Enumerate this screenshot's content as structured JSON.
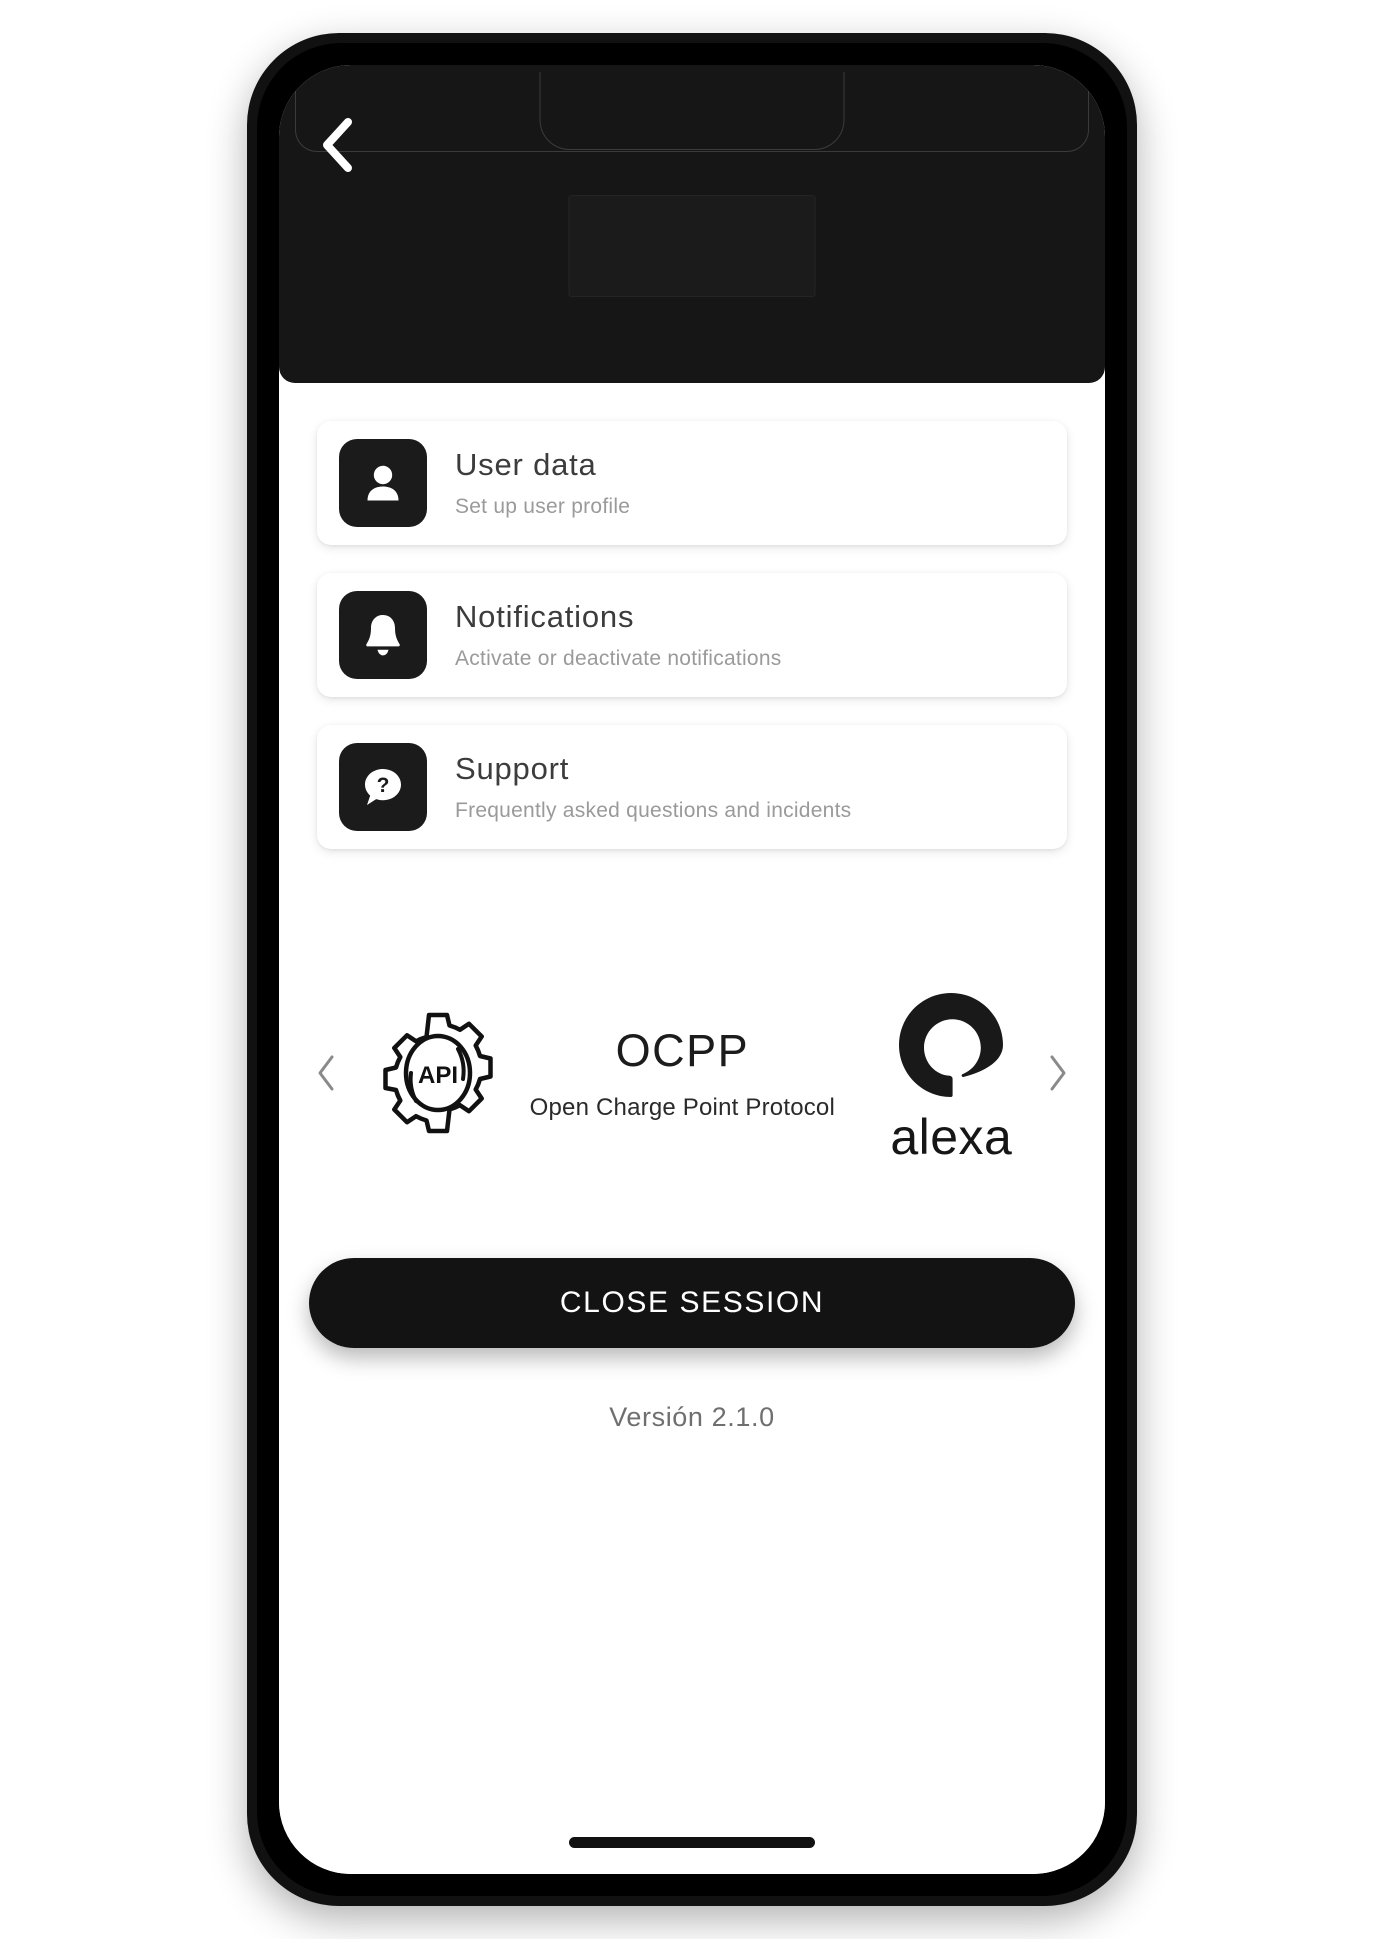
{
  "header": {
    "back_icon": "chevron-left-icon",
    "background_color": "#161616"
  },
  "menu": {
    "items": [
      {
        "icon": "user-icon",
        "title": "User data",
        "subtitle": "Set up user profile"
      },
      {
        "icon": "bell-icon",
        "title": "Notifications",
        "subtitle": "Activate or deactivate notifications"
      },
      {
        "icon": "question-bubble-icon",
        "title": "Support",
        "subtitle": "Frequently asked questions and incidents"
      }
    ]
  },
  "carousel": {
    "prev_icon": "chevron-left-icon",
    "next_icon": "chevron-right-icon",
    "slides": [
      {
        "icon": "api-gear-icon",
        "icon_label": "API",
        "title": "OCPP",
        "subtitle": "Open Charge Point Protocol"
      },
      {
        "icon": "alexa-ring-icon",
        "wordmark": "alexa"
      }
    ]
  },
  "footer": {
    "close_session_label": "CLOSE SESSION",
    "version": "Versión 2.1.0"
  },
  "colors": {
    "accent_dark": "#131313",
    "card_background": "#ffffff",
    "title_text": "#3c3c3c",
    "subtitle_text": "#9a9a9a",
    "page_background": "#ffffff"
  }
}
